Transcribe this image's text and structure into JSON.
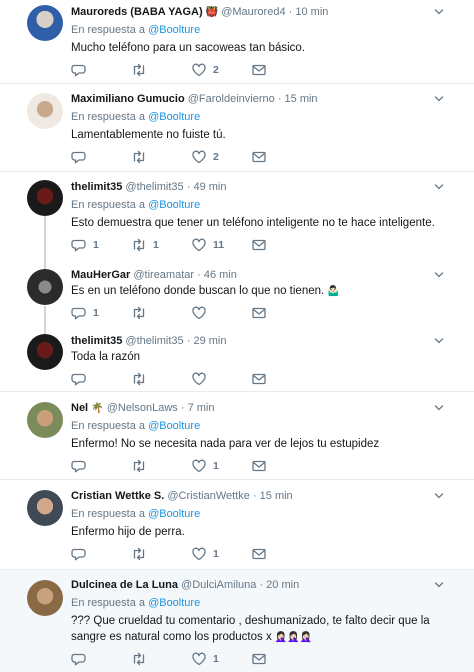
{
  "colors": {
    "accent": "#1b95e0",
    "muted": "#657786",
    "border": "#e6ecf0",
    "highlight": "#f5f8fa"
  },
  "tweets": [
    {
      "name": "Mauroreds (BABA YAGA)",
      "name_emoji": "👹",
      "handle": "@Maurored4",
      "time": "· 10 min",
      "reply_prefix": "En respuesta a",
      "reply_to": "@Boolture",
      "text": "Mucho teléfono para un sacoweas tan básico.",
      "replies": "",
      "retweets": "",
      "likes": "2"
    },
    {
      "name": "Maximiliano Gumucio",
      "handle": "@Faroldeinvierno",
      "time": "· 15 min",
      "reply_prefix": "En respuesta a",
      "reply_to": "@Boolture",
      "text": "Lamentablemente no fuiste tú.",
      "replies": "",
      "retweets": "",
      "likes": "2"
    },
    {
      "name": "thelimit35",
      "handle": "@thelimit35",
      "time": "· 49 min",
      "reply_prefix": "En respuesta a",
      "reply_to": "@Boolture",
      "text": "Esto demuestra que tener un teléfono inteligente no te hace inteligente.",
      "replies": "1",
      "retweets": "1",
      "likes": "11"
    },
    {
      "name": "MauHerGar",
      "handle": "@tireamatar",
      "time": "· 46 min",
      "text": "Es en un teléfono donde buscan lo que no tienen.",
      "text_emoji": "🤷🏻‍♂️",
      "replies": "1",
      "retweets": "",
      "likes": ""
    },
    {
      "name": "thelimit35",
      "handle": "@thelimit35",
      "time": "· 29 min",
      "text": "Toda la razón",
      "replies": "",
      "retweets": "",
      "likes": ""
    },
    {
      "name": "Nel",
      "name_emoji": "🌴",
      "handle": "@NelsonLaws",
      "time": "· 7 min",
      "reply_prefix": "En respuesta a",
      "reply_to": "@Boolture",
      "text": "Enfermo! No se necesita nada para ver de lejos tu estupidez",
      "replies": "",
      "retweets": "",
      "likes": "1"
    },
    {
      "name": "Cristian Wettke S.",
      "handle": "@CristianWettke",
      "time": "· 15 min",
      "reply_prefix": "En respuesta a",
      "reply_to": "@Boolture",
      "text": "Enfermo hijo de perra.",
      "replies": "",
      "retweets": "",
      "likes": "1"
    },
    {
      "name": "Dulcinea de La Luna",
      "handle": "@DulciAmiluna",
      "time": "· 20 min",
      "reply_prefix": "En respuesta a",
      "reply_to": "@Boolture",
      "text": "??? Que crueldad tu comentario , deshumanizado, te falto decir que la sangre es natural como los productos x",
      "text_emoji": "🤦🏻‍♀️🤦🏻‍♀️🤦🏻‍♀️",
      "replies": "",
      "retweets": "",
      "likes": "1"
    }
  ]
}
